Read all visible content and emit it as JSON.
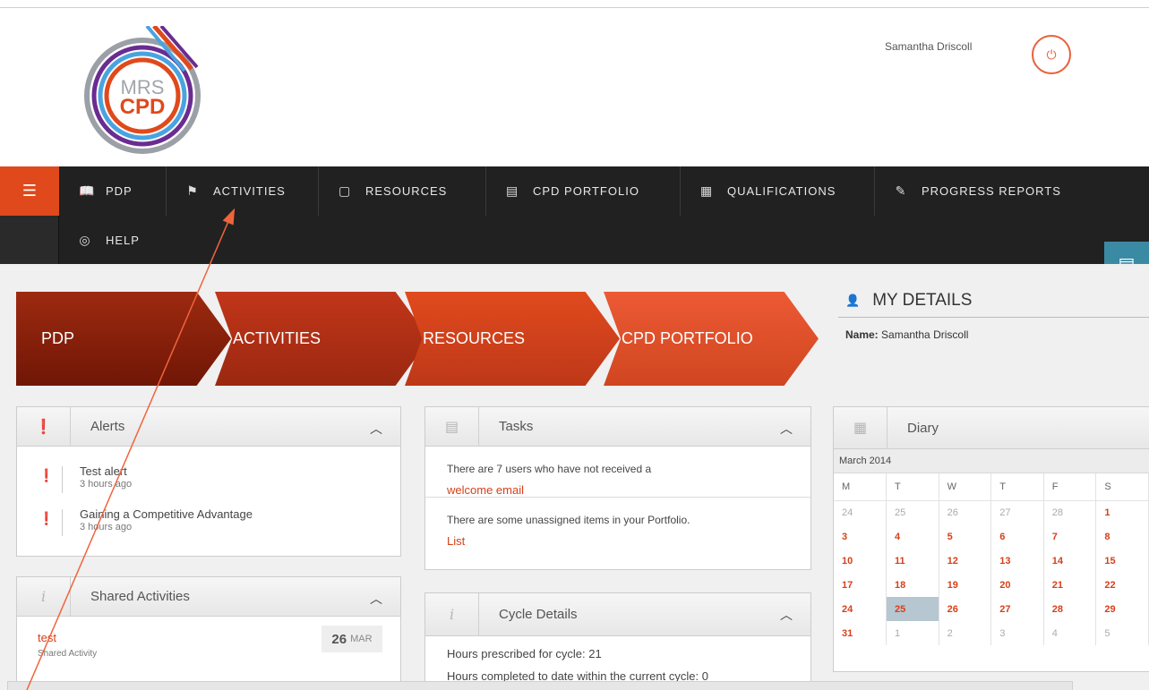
{
  "header": {
    "logo_text": [
      "MRS",
      "CPD"
    ],
    "user_name": "Samantha Driscoll"
  },
  "nav": {
    "items": [
      {
        "label": "PDP",
        "icon": "book-icon"
      },
      {
        "label": "ACTIVITIES",
        "icon": "activities-icon"
      },
      {
        "label": "RESOURCES",
        "icon": "folder-icon"
      },
      {
        "label": "CPD PORTFOLIO",
        "icon": "clipboard-icon"
      },
      {
        "label": "QUALIFICATIONS",
        "icon": "document-icon"
      },
      {
        "label": "PROGRESS REPORTS",
        "icon": "edit-icon"
      },
      {
        "label": "HELP",
        "icon": "lifebuoy-icon"
      }
    ]
  },
  "steps": [
    "PDP",
    "ACTIVITIES",
    "RESOURCES",
    "CPD PORTFOLIO"
  ],
  "my_details": {
    "title": "MY DETAILS",
    "name_label": "Name:",
    "name_value": "Samantha Driscoll"
  },
  "alerts": {
    "title": "Alerts",
    "items": [
      {
        "title": "Test alert",
        "time": "3 hours ago"
      },
      {
        "title": "Gaining a Competitive Advantage",
        "time": "3 hours ago"
      }
    ]
  },
  "tasks": {
    "title": "Tasks",
    "items": [
      {
        "text": "There are 7 users who have not received a",
        "link": "welcome email"
      },
      {
        "text": "There are some unassigned items in your Portfolio.",
        "link": "List"
      }
    ]
  },
  "shared": {
    "title": "Shared Activities",
    "item_title": "test",
    "item_sub": "Shared Activity",
    "day": "26",
    "month": "MAR"
  },
  "cycle": {
    "title": "Cycle Details",
    "line1": "Hours prescribed for cycle: 21",
    "line2": "Hours completed to date within the current cycle: 0"
  },
  "diary": {
    "title": "Diary",
    "month": "March 2014",
    "dow": [
      "M",
      "T",
      "W",
      "T",
      "F",
      "S"
    ],
    "weeks": [
      [
        "24",
        "25",
        "26",
        "27",
        "28",
        "1"
      ],
      [
        "3",
        "4",
        "5",
        "6",
        "7",
        "8"
      ],
      [
        "10",
        "11",
        "12",
        "13",
        "14",
        "15"
      ],
      [
        "17",
        "18",
        "19",
        "20",
        "21",
        "22"
      ],
      [
        "24",
        "25",
        "26",
        "27",
        "28",
        "29"
      ],
      [
        "31",
        "1",
        "2",
        "3",
        "4",
        "5"
      ]
    ]
  },
  "colors": {
    "accent": "#e0491b",
    "nav_bg": "#212121",
    "link": "#d6401a",
    "annotation": "#f0643c"
  }
}
